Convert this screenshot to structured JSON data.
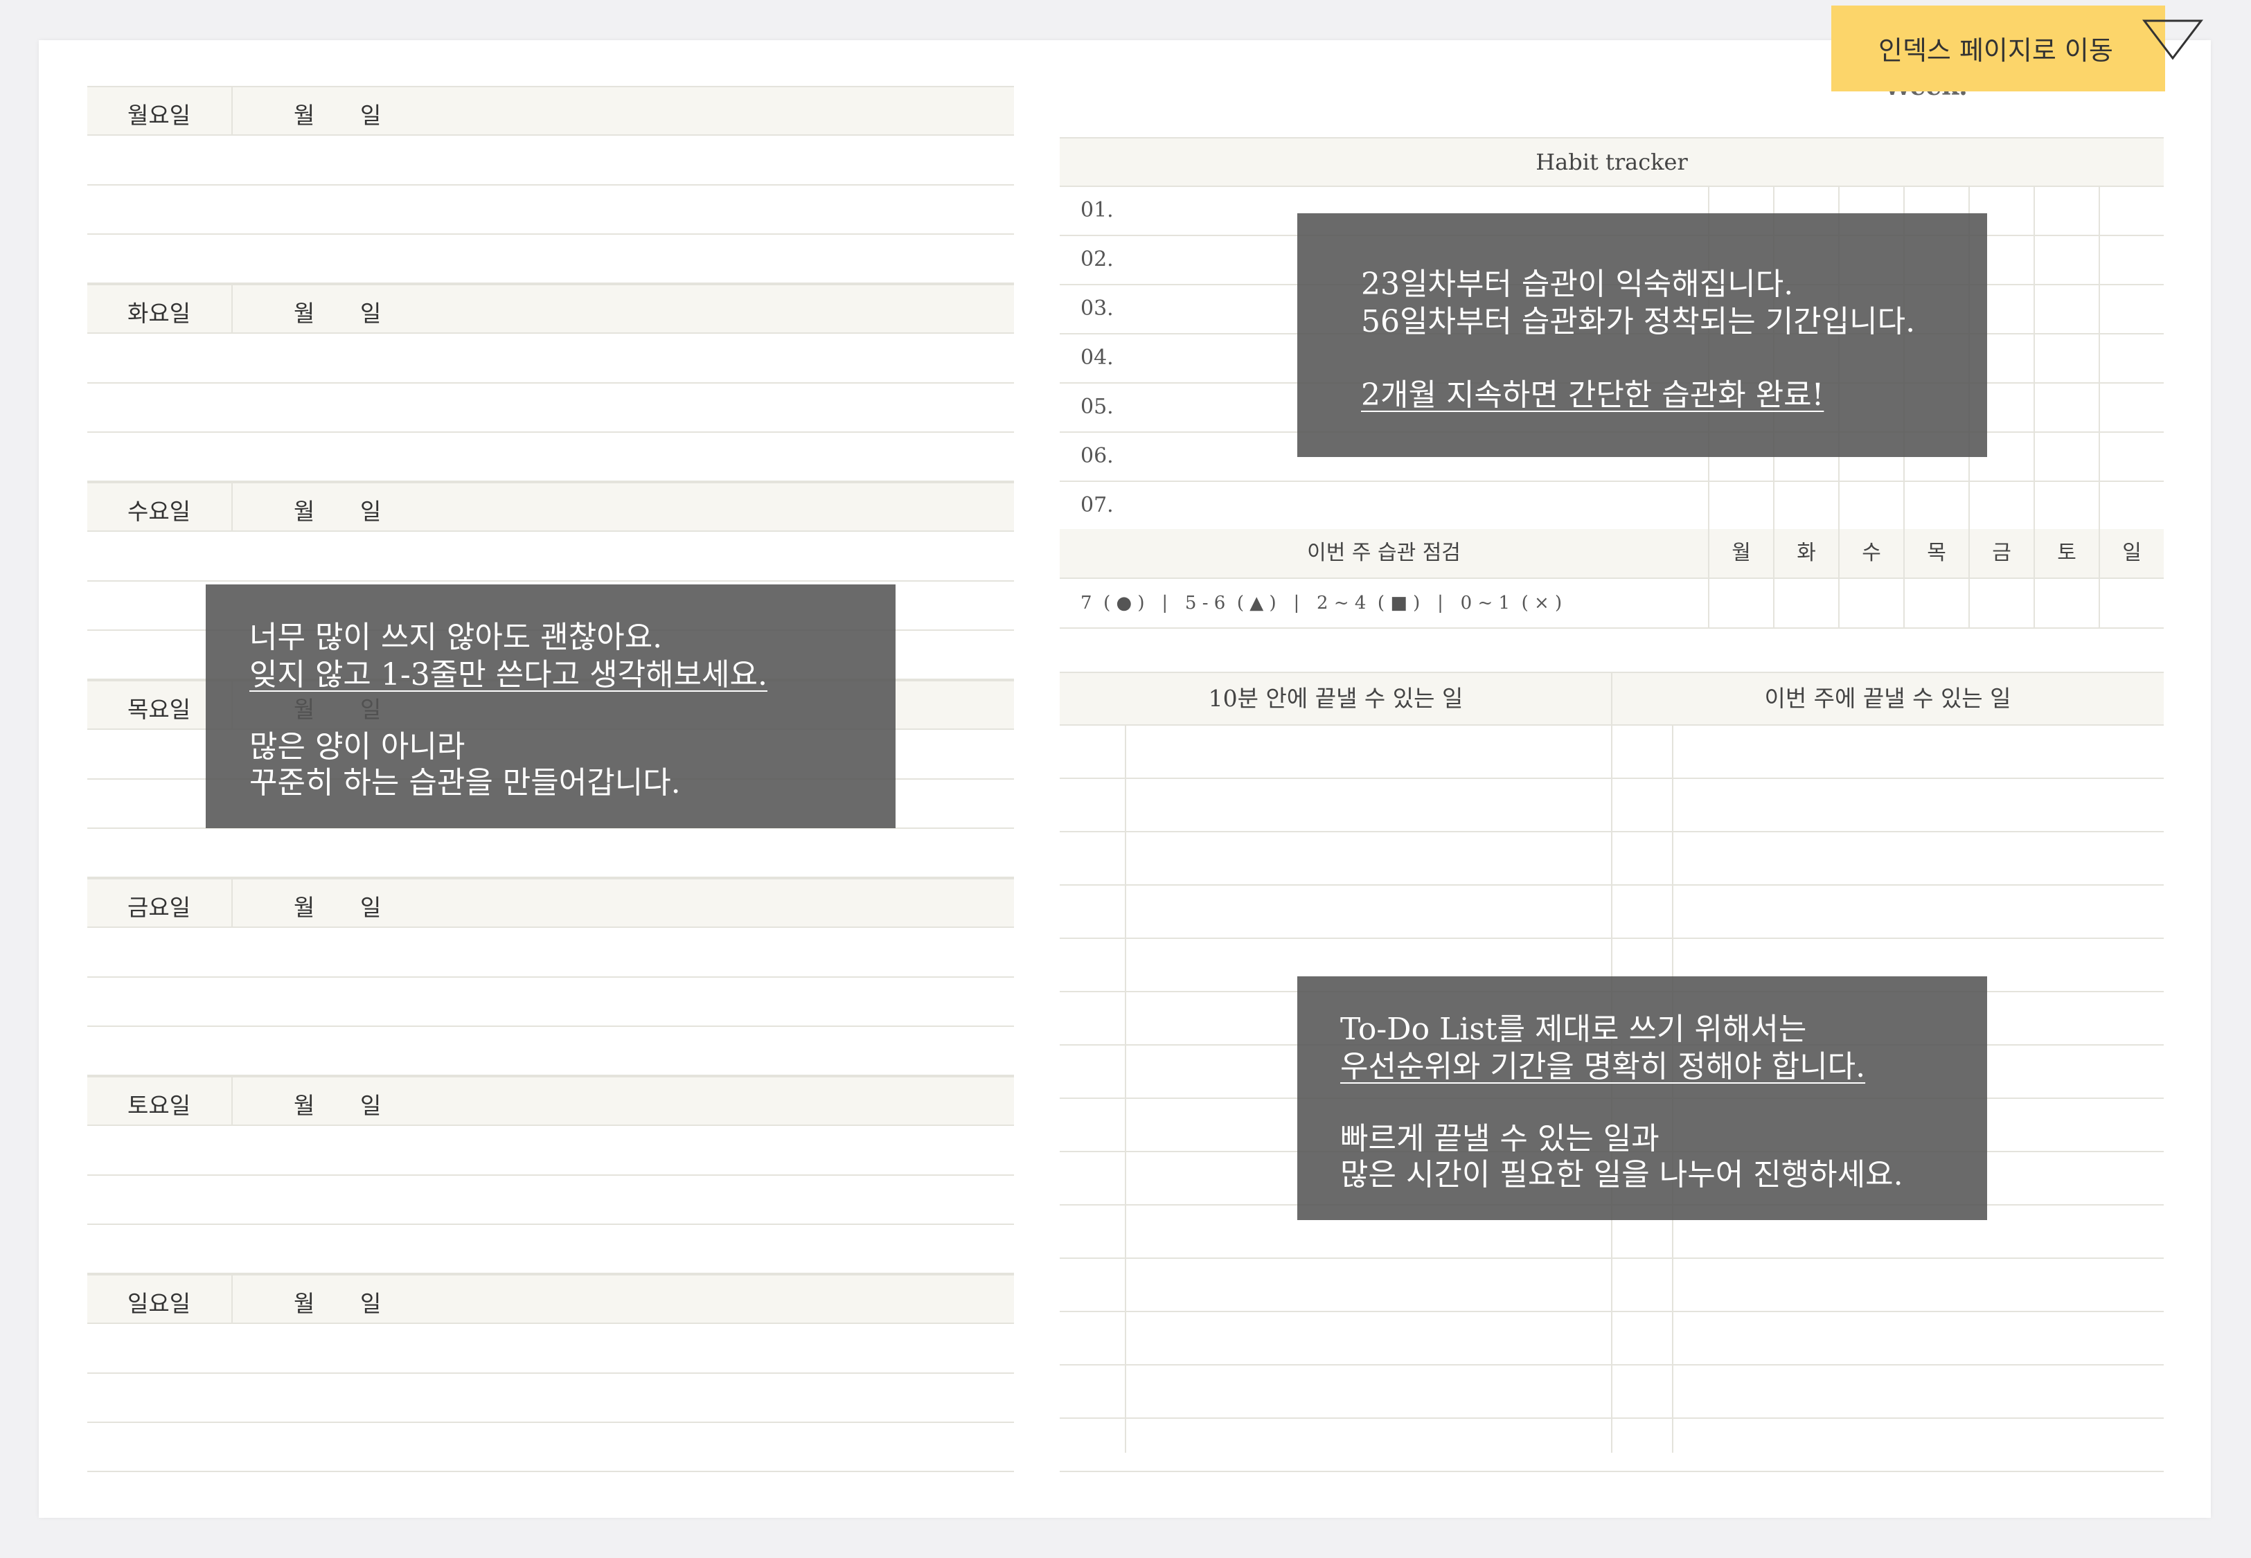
{
  "index_button": {
    "label": "인덱스 페이지로 이동"
  },
  "week_label": "Week.",
  "days": [
    {
      "name": "월요일",
      "month": "월",
      "day": "일"
    },
    {
      "name": "화요일",
      "month": "월",
      "day": "일"
    },
    {
      "name": "수요일",
      "month": "월",
      "day": "일"
    },
    {
      "name": "목요일",
      "month": "월",
      "day": "일"
    },
    {
      "name": "금요일",
      "month": "월",
      "day": "일"
    },
    {
      "name": "토요일",
      "month": "월",
      "day": "일"
    },
    {
      "name": "일요일",
      "month": "월",
      "day": "일"
    }
  ],
  "habit_tracker": {
    "title": "Habit tracker",
    "rows": [
      "01.",
      "02.",
      "03.",
      "04.",
      "05.",
      "06.",
      "07."
    ],
    "check_title": "이번 주 습관 점검",
    "weekdays": [
      "월",
      "화",
      "수",
      "목",
      "금",
      "토",
      "일"
    ],
    "legend": "7  ( ● )   |   5 - 6  ( ▲ )   |   2 ~ 4  ( ■ )   |   0 ~ 1  ( × )"
  },
  "todo": {
    "col1": "10분 안에 끝낼 수 있는 일",
    "col2": "이번 주에 끝낼 수 있는 일"
  },
  "tips": {
    "habit": {
      "line1": "23일차부터 습관이 익숙해집니다.",
      "line2": "56일차부터 습관화가 정착되는 기간입니다.",
      "line3": "2개월 지속하면 간단한 습관화 완료!"
    },
    "daily": {
      "line1": "너무 많이 쓰지 않아도 괜찮아요.",
      "line2": "잊지 않고 1-3줄만 쓴다고 생각해보세요.",
      "line3": "많은 양이 아니라",
      "line4": "꾸준히 하는 습관을 만들어갑니다."
    },
    "todo": {
      "line1": "To-Do List를 제대로 쓰기 위해서는",
      "line2": "우선순위와 기간을 명확히 정해야 합니다.",
      "line3": "빠르게 끝낼 수 있는 일과",
      "line4": "많은 시간이 필요한 일을 나누어 진행하세요."
    }
  }
}
